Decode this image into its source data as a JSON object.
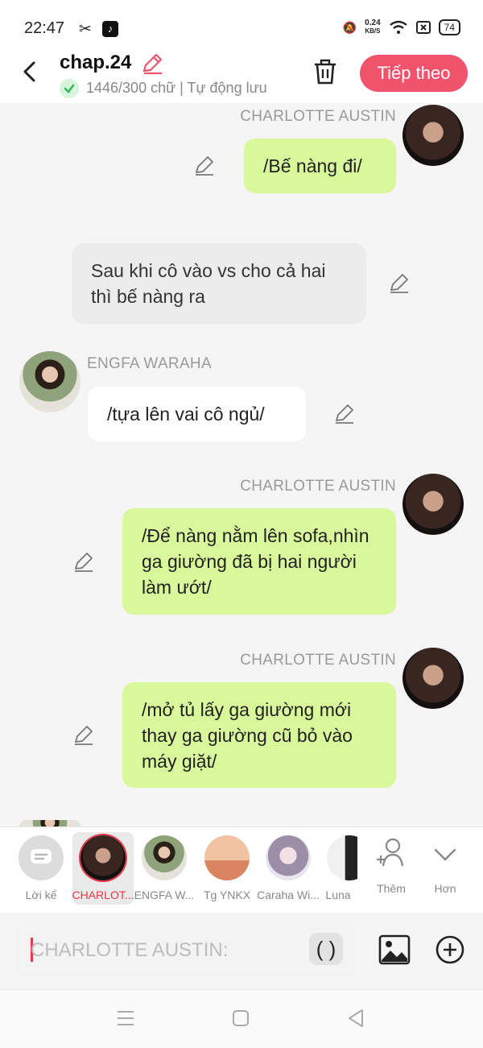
{
  "status_bar": {
    "time": "22:47",
    "net_speed_value": "0.24",
    "net_speed_unit": "KB/S",
    "battery": "74"
  },
  "header": {
    "title": "chap.24",
    "subtitle": "1446/300 chữ | Tự động lưu",
    "next_button": "Tiếp theo"
  },
  "messages": [
    {
      "speaker": "CHARLOTTE AUSTIN",
      "text": "/Bế nàng đi/"
    },
    {
      "speaker": "",
      "text": "Sau khi cô vào vs cho cả hai thì bế nàng ra"
    },
    {
      "speaker": "ENGFA WARAHA",
      "text": "/tựa lên vai cô ngủ/"
    },
    {
      "speaker": "CHARLOTTE AUSTIN",
      "text": "/Để nàng nằm lên sofa,nhìn ga giường đã bị hai người làm ướt/"
    },
    {
      "speaker": "CHARLOTTE AUSTIN",
      "text": "/mở tủ lấy ga giường mới thay ga giường cũ bỏ vào máy giặt/"
    }
  ],
  "characters": [
    {
      "label": "Lời kể"
    },
    {
      "label": "CHARLOT..."
    },
    {
      "label": "ENGFA W..."
    },
    {
      "label": "Tg YNKX"
    },
    {
      "label": "Caraha Wi..."
    },
    {
      "label": "Luna"
    }
  ],
  "add_more_label": "Thêm",
  "more_label": "Hơn",
  "input": {
    "placeholder": "CHARLOTTE AUSTIN:",
    "paren_button": "( )"
  },
  "colors": {
    "accent": "#f0536b",
    "bubble_green": "#d9f79b",
    "selected_red": "#e53946"
  }
}
